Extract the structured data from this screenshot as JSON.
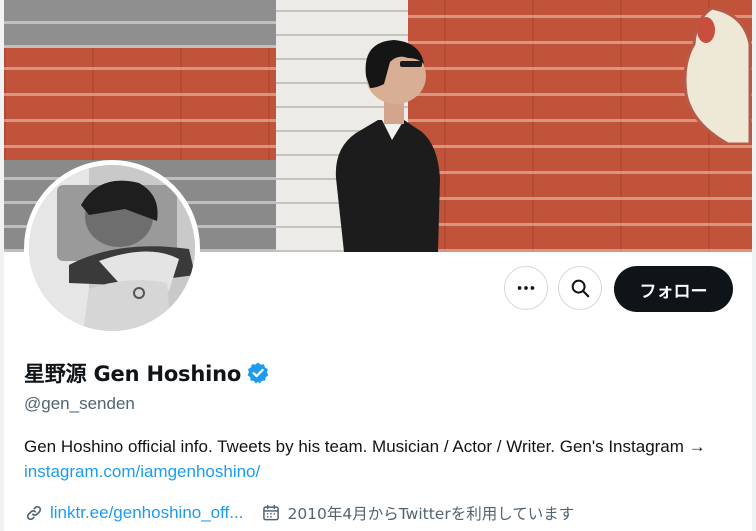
{
  "profile": {
    "display_name": "星野源 Gen Hoshino",
    "handle": "@gen_senden",
    "verified": true,
    "bio_text": "Gen Hoshino official info. Tweets by his team. Musician / Actor / Writer. Gen's Instagram → ",
    "bio_link": "instagram.com/iamgenhoshino/",
    "website_link": "linktr.ee/genhoshino_off...",
    "joined": "2010年4月からTwitterを利用しています"
  },
  "actions": {
    "more_icon": "more-horizontal-icon",
    "search_icon": "search-icon",
    "follow_label": "フォロー"
  },
  "icons": {
    "verified": "verified-badge-icon",
    "link": "link-icon",
    "calendar": "calendar-icon"
  },
  "colors": {
    "accent": "#1d9bf0",
    "text_primary": "#0f1419",
    "text_secondary": "#536471",
    "follow_button_bg": "#0f1419",
    "border": "#cfd9de"
  }
}
